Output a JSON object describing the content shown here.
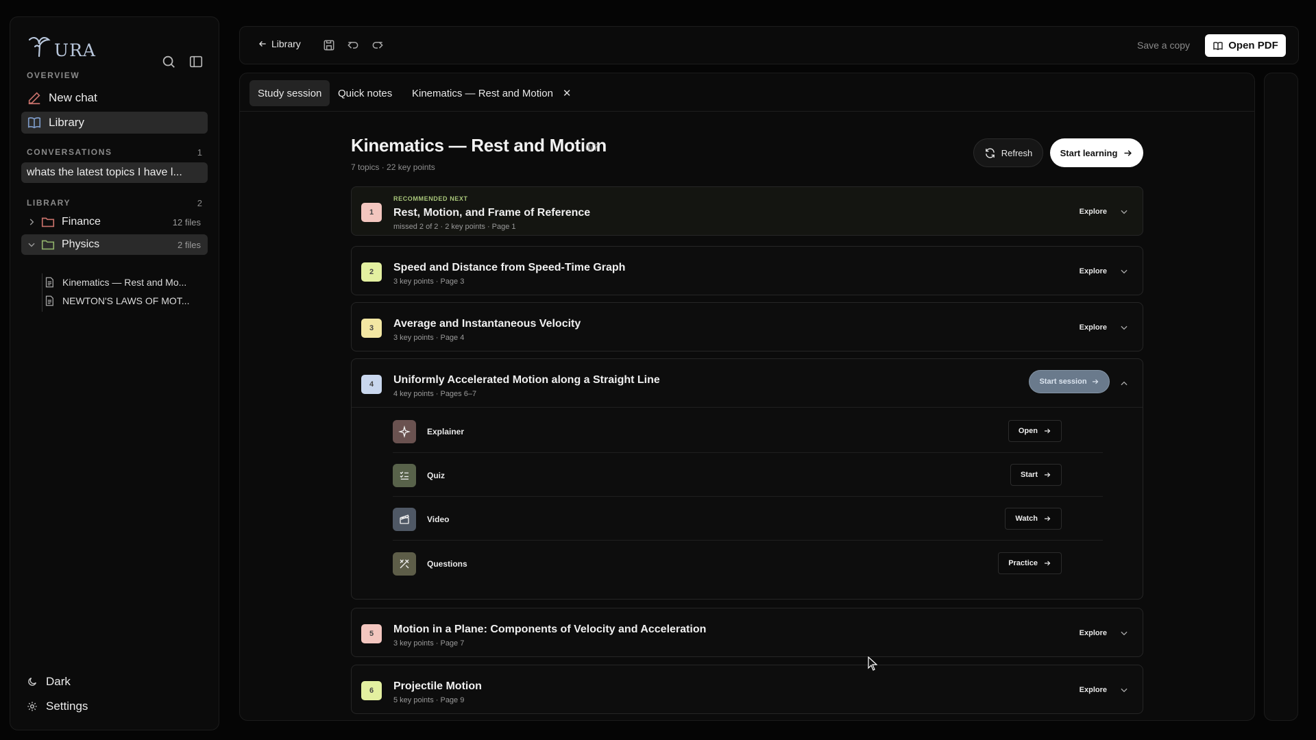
{
  "app": {
    "name": "URA"
  },
  "sidebar": {
    "overview_label": "OVERVIEW",
    "new_chat": "New chat",
    "library": "Library",
    "conversations_label": "CONVERSATIONS",
    "conversations_count": "1",
    "conversation_item": "whats the latest topics I have l...",
    "library_label": "LIBRARY",
    "library_count": "2",
    "folders": [
      {
        "name": "Finance",
        "count": "12 files",
        "color": "#c9726b",
        "expanded": false
      },
      {
        "name": "Physics",
        "count": "2 files",
        "color": "#8fb06a",
        "expanded": true
      }
    ],
    "files": [
      "Kinematics — Rest and Mo...",
      "NEWTON'S LAWS OF MOT..."
    ],
    "dark": "Dark",
    "settings": "Settings"
  },
  "topbar": {
    "back": "Library",
    "save_copy": "Save a copy",
    "open_pdf": "Open PDF"
  },
  "tabs": [
    {
      "label": "Study session",
      "active": true
    },
    {
      "label": "Quick notes",
      "active": false
    },
    {
      "label": "Kinematics — Rest and Motion",
      "active": false,
      "closable": true
    }
  ],
  "document": {
    "title": "Kinematics — Rest and Motion",
    "progress": "0/7",
    "meta": "7 topics · 22 key points",
    "refresh": "Refresh",
    "start_learning": "Start learning"
  },
  "topics": [
    {
      "num": "1",
      "title": "Rest, Motion, and Frame of Reference",
      "sub": "missed 2 of 2 · 2 key points · Page 1",
      "color": "#f3c6bf",
      "recommended": "RECOMMENDED NEXT",
      "action": "Explore"
    },
    {
      "num": "2",
      "title": "Speed and Distance from Speed-Time Graph",
      "sub": "3 key points · Page 3",
      "color": "#e3f0a0",
      "action": "Explore"
    },
    {
      "num": "3",
      "title": "Average and Instantaneous Velocity",
      "sub": "3 key points · Page 4",
      "color": "#f3e7a3",
      "action": "Explore"
    },
    {
      "num": "4",
      "title": "Uniformly Accelerated Motion along a Straight Line",
      "sub": "4 key points · Pages 6–7",
      "color": "#c9d7ee",
      "action": "Start session"
    },
    {
      "num": "5",
      "title": "Motion in a Plane: Components of Velocity and Acceleration",
      "sub": "3 key points · Page 7",
      "color": "#f3c6bf",
      "action": "Explore"
    },
    {
      "num": "6",
      "title": "Projectile Motion",
      "sub": "5 key points · Page 9",
      "color": "#e3f0a0",
      "action": "Explore"
    }
  ],
  "subitems": [
    {
      "label": "Explainer",
      "button": "Open",
      "icon": "sparkle-icon",
      "color": "#6a5250"
    },
    {
      "label": "Quiz",
      "button": "Start",
      "icon": "checklist-icon",
      "color": "#58624a"
    },
    {
      "label": "Video",
      "button": "Watch",
      "icon": "clapperboard-icon",
      "color": "#4f5865"
    },
    {
      "label": "Questions",
      "button": "Practice",
      "icon": "tools-icon",
      "color": "#5d5d48"
    }
  ]
}
